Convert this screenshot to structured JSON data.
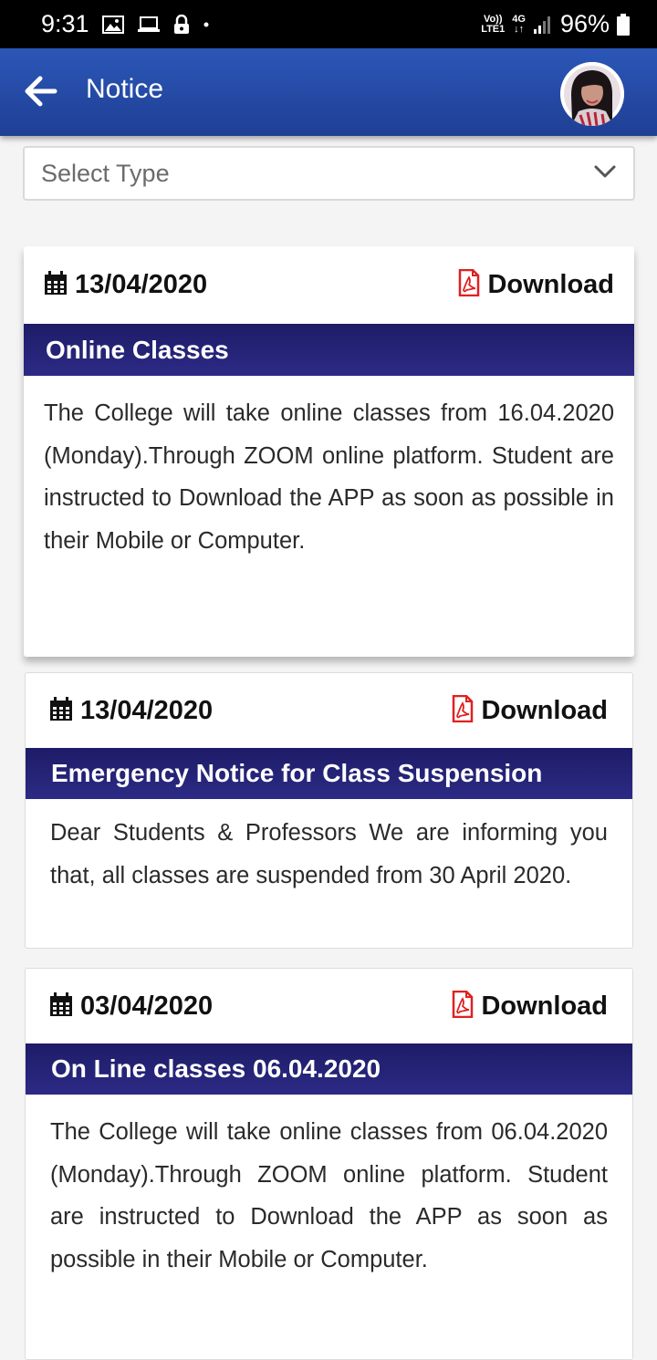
{
  "status_bar": {
    "time": "9:31",
    "volte": "Vo))",
    "lte": "LTE1",
    "network": "4G",
    "battery": "96%"
  },
  "app_bar": {
    "title": "Notice"
  },
  "filter": {
    "placeholder": "Select Type"
  },
  "download_label": "Download",
  "notices": [
    {
      "date": "13/04/2020",
      "title": "Online Classes",
      "body": "The College will take online classes from 16.04.2020 (Monday).Through ZOOM online platform. Student are instructed to Download the APP as soon as possible in their Mobile or Computer."
    },
    {
      "date": "13/04/2020",
      "title": "Emergency Notice for Class Suspension",
      "body": "Dear Students & Professors We are informing you that, all classes are suspended from 30 April 2020."
    },
    {
      "date": "03/04/2020",
      "title": "On Line classes 06.04.2020",
      "body": "The College will take online classes from 06.04.2020 (Monday).Through ZOOM online platform. Student are instructed to Download the APP as soon as possible in their Mobile or Computer."
    }
  ],
  "colors": {
    "app_bar": "#2b57b8",
    "banner": "#1e1c67",
    "pdf_icon": "#e02020"
  }
}
